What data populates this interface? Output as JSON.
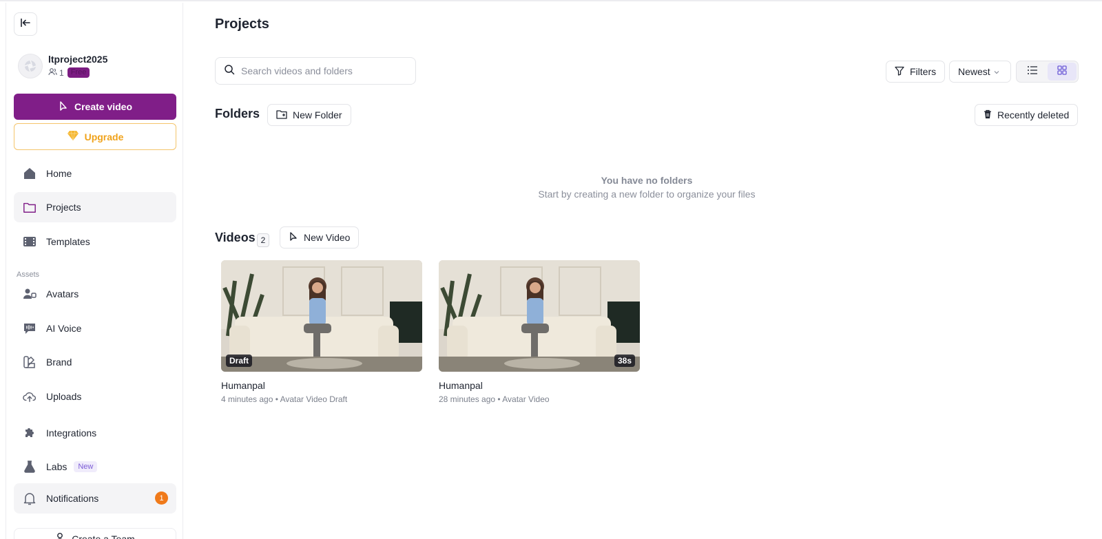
{
  "sidebar": {
    "workspace": {
      "name": "ltproject2025",
      "members": "1",
      "plan": "Free"
    },
    "create_label": "Create video",
    "upgrade_label": "Upgrade",
    "nav": {
      "home": "Home",
      "projects": "Projects",
      "templates": "Templates",
      "assets_section": "Assets",
      "avatars": "Avatars",
      "ai_voice": "AI Voice",
      "brand": "Brand",
      "uploads": "Uploads",
      "integrations": "Integrations",
      "labs": "Labs",
      "labs_badge": "New",
      "notifications": "Notifications",
      "notifications_count": "1",
      "create_team": "Create a Team"
    }
  },
  "main": {
    "title": "Projects",
    "search_placeholder": "Search videos and folders",
    "filters_label": "Filters",
    "sort_label": "Newest",
    "folders": {
      "title": "Folders",
      "new_label": "New Folder",
      "recently_deleted_label": "Recently deleted",
      "empty_title": "You have no folders",
      "empty_sub": "Start by creating a new folder to organize your files"
    },
    "videos": {
      "title": "Videos",
      "count": "2",
      "new_label": "New Video",
      "items": [
        {
          "title": "Humanpal",
          "meta": "4 minutes ago • Avatar Video Draft",
          "badge": "Draft"
        },
        {
          "title": "Humanpal",
          "meta": "28 minutes ago • Avatar Video",
          "badge": "38s"
        }
      ]
    }
  },
  "colors": {
    "brand": "#801e88",
    "upgrade": "#f0a21a",
    "notification": "#f07a1a",
    "active_view": "#6b5ad6"
  }
}
